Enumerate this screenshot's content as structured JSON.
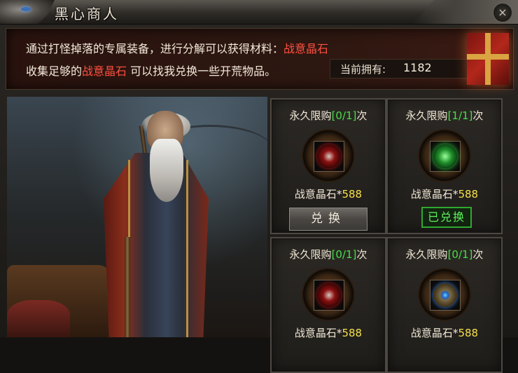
{
  "window": {
    "title": "黑心商人",
    "close_icon": "×"
  },
  "info": {
    "line1_text": "通过打怪掉落的专属装备，进行分解可以获得材料：",
    "line1_highlight": "战意晶石",
    "line2_prefix": "收集足够的",
    "line2_highlight": "战意晶石",
    "line2_suffix": " 可以找我兑换一些开荒物品。",
    "owned_label": "当前拥有:",
    "owned_value": "1182"
  },
  "items": [
    {
      "limit_prefix": "永久限购",
      "limit_count": "[0/1]",
      "limit_suffix": "次",
      "cost_name": "战意晶石*",
      "cost_value": "588",
      "gem": "red-skull-gem-icon",
      "button_label": "兑换",
      "status": "available"
    },
    {
      "limit_prefix": "永久限购",
      "limit_count": "[1/1]",
      "limit_suffix": "次",
      "cost_name": "战意晶石*",
      "cost_value": "588",
      "gem": "green-gem-icon",
      "status_label": "已兑换",
      "status": "redeemed"
    },
    {
      "limit_prefix": "永久限购",
      "limit_count": "[0/1]",
      "limit_suffix": "次",
      "cost_name": "战意晶石*",
      "cost_value": "588",
      "gem": "red-gem-icon",
      "status": "available"
    },
    {
      "limit_prefix": "永久限购",
      "limit_count": "[0/1]",
      "limit_suffix": "次",
      "cost_name": "战意晶石*",
      "cost_value": "588",
      "gem": "blue-gem-icon",
      "status": "available"
    }
  ]
}
